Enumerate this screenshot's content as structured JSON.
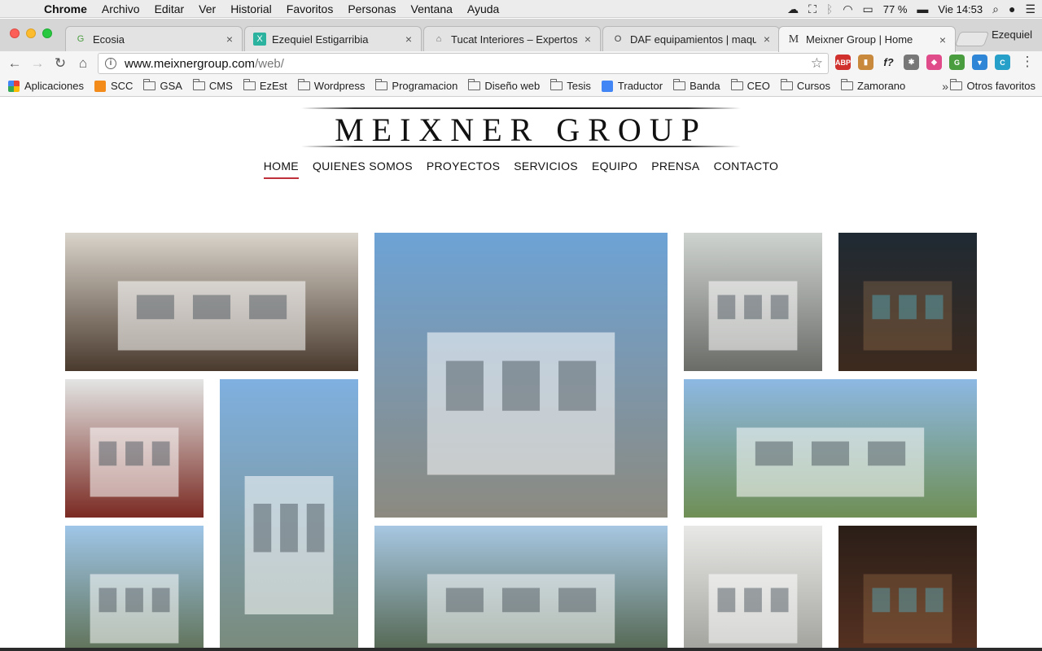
{
  "menubar": {
    "apple_icon": "apple-icon",
    "items": [
      "Chrome",
      "Archivo",
      "Editar",
      "Ver",
      "Historial",
      "Favoritos",
      "Personas",
      "Ventana",
      "Ayuda"
    ],
    "battery": "77 %",
    "clock": "Vie 14:53"
  },
  "tabs": [
    {
      "title": "Ecosia",
      "favicon": "G",
      "color": "#4a9d3f"
    },
    {
      "title": "Ezequiel Estigarribia",
      "favicon": "X",
      "color": "#2bb3a0"
    },
    {
      "title": "Tucat Interiores – Expertos a",
      "favicon": "⌂",
      "color": "#666666"
    },
    {
      "title": "DAF equipamientos | maquin",
      "favicon": "O",
      "color": "#444444"
    },
    {
      "title": "Meixner Group | Home",
      "favicon": "M",
      "color": "#333333"
    }
  ],
  "profile_name": "Ezequiel",
  "address": {
    "host": "www.meixnergroup.com",
    "path": "/web/"
  },
  "extensions": [
    {
      "label": "ABP",
      "color": "#d0312d"
    },
    {
      "label": "▮",
      "color": "#c9893d"
    },
    {
      "label": "f?",
      "color": "#ffffff"
    },
    {
      "label": "✱",
      "color": "#777777"
    },
    {
      "label": "◆",
      "color": "#e04b8a"
    },
    {
      "label": "G",
      "color": "#4a9d3f"
    },
    {
      "label": "▼",
      "color": "#2f86d6"
    },
    {
      "label": "C",
      "color": "#27a0c9"
    }
  ],
  "bookmarks": {
    "apps_label": "Aplicaciones",
    "items": [
      "SCC",
      "GSA",
      "CMS",
      "EzEst",
      "Wordpress",
      "Programacion",
      "Diseño web",
      "Tesis",
      "Traductor",
      "Banda",
      "CEO",
      "Cursos",
      "Zamorano"
    ],
    "more": "»",
    "others": "Otros favoritos"
  },
  "site": {
    "logo": "MEIXNER GROUP",
    "nav": [
      "HOME",
      "QUIENES SOMOS",
      "PROYECTOS",
      "SERVICIOS",
      "EQUIPO",
      "PRENSA",
      "CONTACTO"
    ],
    "active_nav": "HOME"
  },
  "gallery": [
    {
      "name": "living-room-fireplace",
      "sky": "#d9d4cb",
      "ground": "#4a3a2e"
    },
    {
      "name": "white-mansion",
      "sky": "#6da3d6",
      "ground": "#8c8a80"
    },
    {
      "name": "dining-room-interior",
      "sky": "#cfd3d0",
      "ground": "#6a6c68"
    },
    {
      "name": "bar-lounge-night",
      "sky": "#1f2a33",
      "ground": "#3d2a1e"
    },
    {
      "name": "modern-kitchen-living",
      "sky": "#e3e5e4",
      "ground": "#7a2a22"
    },
    {
      "name": "residential-tower",
      "sky": "#7fb0e0",
      "ground": "#7a8a7a"
    },
    {
      "name": "classic-house-garden",
      "sky": "#8db8e3",
      "ground": "#6f8f55"
    },
    {
      "name": "townhouse-facade",
      "sky": "#9fc6e8",
      "ground": "#5a6a4a"
    },
    {
      "name": "modern-house-pool",
      "sky": "#a7c7e2",
      "ground": "#4d5e44"
    },
    {
      "name": "apartment-interior",
      "sky": "#e8e8e6",
      "ground": "#9b9b96"
    },
    {
      "name": "restaurant-interior",
      "sky": "#2a1e18",
      "ground": "#5a3322"
    }
  ]
}
